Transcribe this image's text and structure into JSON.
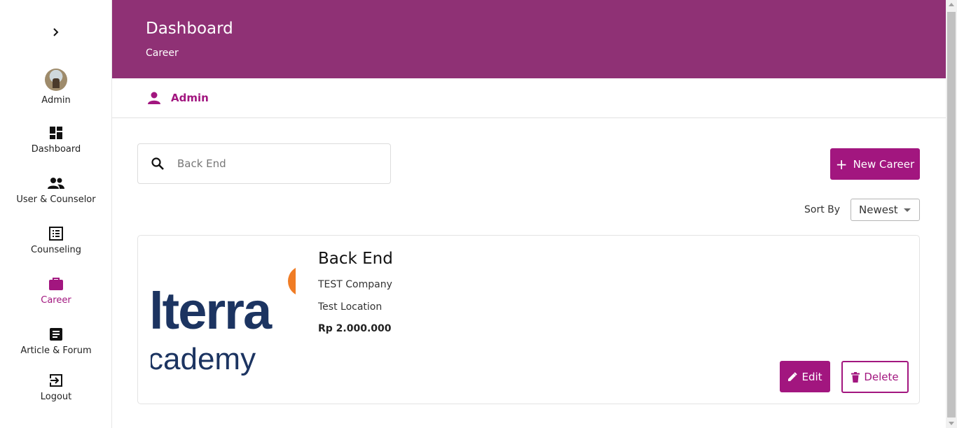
{
  "sidebar": {
    "items": [
      {
        "label": "Admin",
        "icon": "avatar"
      },
      {
        "label": "Dashboard",
        "icon": "dashboard-icon"
      },
      {
        "label": "User & Counselor",
        "icon": "people-icon"
      },
      {
        "label": "Counseling",
        "icon": "list-icon"
      },
      {
        "label": "Career",
        "icon": "briefcase-icon",
        "active": true
      },
      {
        "label": "Article & Forum",
        "icon": "article-icon"
      },
      {
        "label": "Logout",
        "icon": "logout-icon"
      }
    ]
  },
  "header": {
    "title": "Dashboard",
    "subtitle": "Career"
  },
  "userbar": {
    "name": "Admin"
  },
  "search": {
    "value": "Back End"
  },
  "toolbar": {
    "new_label": "New Career",
    "sort_label": "Sort By",
    "sort_value": "Newest"
  },
  "career": {
    "title": "Back End",
    "company": "TEST Company",
    "location": "Test Location",
    "salary": "Rp 2.000.000",
    "logo_text_1": "lterra",
    "logo_text_2": "cademy",
    "edit_label": "Edit",
    "delete_label": "Delete"
  },
  "colors": {
    "brand": "#a2167f",
    "header_bg": "#8f3175",
    "logo_navy": "#1c3461",
    "logo_orange": "#f07c25"
  }
}
